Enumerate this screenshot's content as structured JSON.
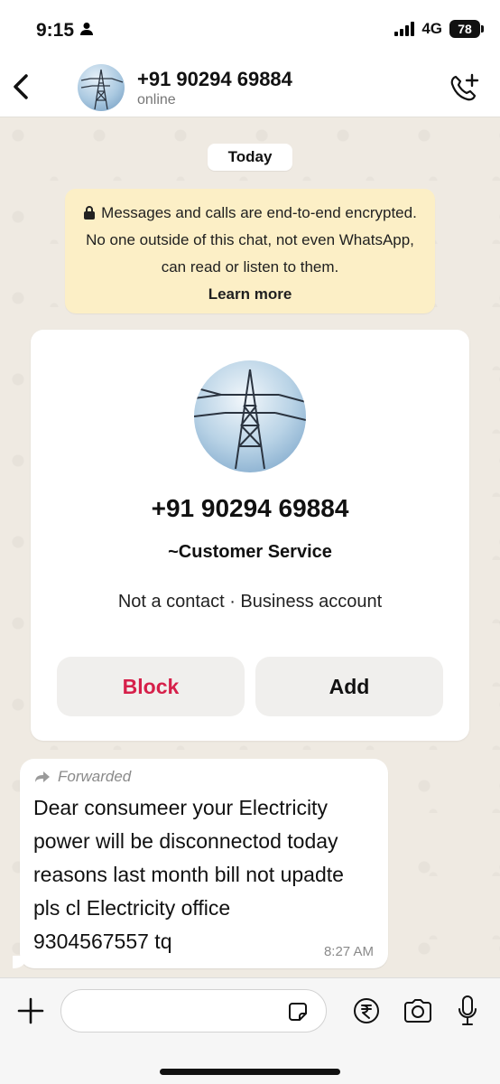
{
  "status_bar": {
    "time": "9:15",
    "network": "4G",
    "battery": "78"
  },
  "header": {
    "contact_name": "+91 90294 69884",
    "status": "online"
  },
  "chat": {
    "date_chip": "Today",
    "encryption_notice": {
      "text": "Messages and calls are end-to-end encrypted. No one outside of this chat, not even WhatsApp, can read or listen to them.",
      "link": "Learn more"
    },
    "contact_card": {
      "phone": "+91 90294 69884",
      "name": "~Customer Service",
      "meta": "Not a contact · Business account",
      "block_label": "Block",
      "add_label": "Add"
    },
    "message": {
      "forwarded_label": "Forwarded",
      "text": "Dear consumeer your Electricity\npower will be disconnectod today\nreasons last month bill not upadte\npls cl Electricity office\n9304567557 tq",
      "time": "8:27 AM"
    }
  },
  "input_bar": {
    "placeholder": ""
  },
  "colors": {
    "block_red": "#d6204a",
    "encryption_bg": "#fcefc6",
    "chat_bg": "#efeae2"
  },
  "icons": [
    "person-icon",
    "signal-icon",
    "back-chevron-icon",
    "add-call-icon",
    "lock-icon",
    "forward-arrow-icon",
    "plus-icon",
    "sticker-icon",
    "rupee-icon",
    "camera-icon",
    "mic-icon"
  ]
}
